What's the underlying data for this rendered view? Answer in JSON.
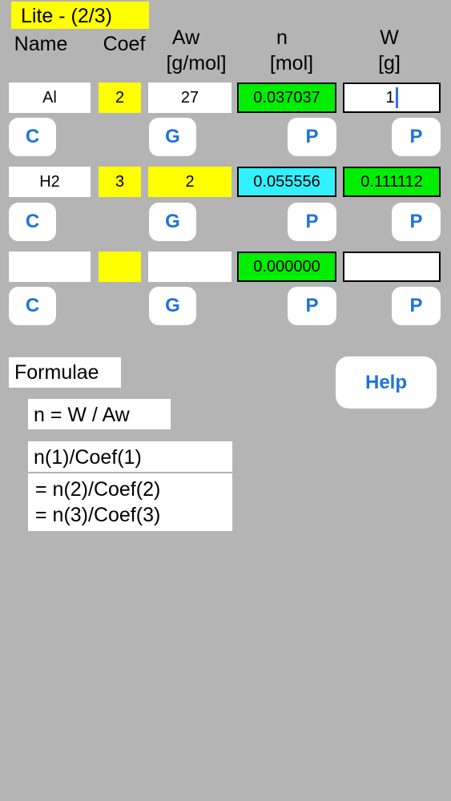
{
  "app": {
    "title": "Lite - (2/3)"
  },
  "headers": {
    "name": "Name",
    "coef": "Coef",
    "aw_line1": "Aw",
    "aw_line2": "[g/mol]",
    "n_line1": "n",
    "n_line2": "[mol]",
    "w_line1": "W",
    "w_line2": "[g]"
  },
  "rows": [
    {
      "name": "Al",
      "coef": "2",
      "aw": "27",
      "n": "0.037037",
      "w": "1",
      "btn_c": "C",
      "btn_g": "G",
      "btn_p_n": "P",
      "btn_p_w": "P"
    },
    {
      "name": "H2",
      "coef": "3",
      "aw": "2",
      "n": "0.055556",
      "w": "0.111112",
      "btn_c": "C",
      "btn_g": "G",
      "btn_p_n": "P",
      "btn_p_w": "P"
    },
    {
      "name": "",
      "coef": "",
      "aw": "",
      "n": "0.000000",
      "w": "",
      "btn_c": "C",
      "btn_g": "G",
      "btn_p_n": "P",
      "btn_p_w": "P"
    }
  ],
  "formulae": {
    "label": "Formulae",
    "eq1": "n = W / Aw",
    "eq2": "n(1)/Coef(1)",
    "eq3": "= n(2)/Coef(2)",
    "eq4": "= n(3)/Coef(3)"
  },
  "help_button": "Help",
  "colors": {
    "background": "#b4b4b4",
    "title_bg": "#ffff00",
    "n_result_green": "#00ee00",
    "n_result_cyan": "#33f0ff",
    "button_text": "#1e73d8"
  }
}
